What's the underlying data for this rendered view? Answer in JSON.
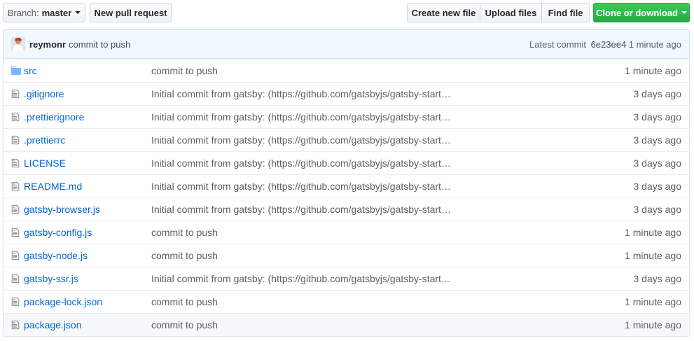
{
  "toolbar": {
    "branch_prefix": "Branch:",
    "branch_name": "master",
    "new_pr_label": "New pull request",
    "create_file_label": "Create new file",
    "upload_files_label": "Upload files",
    "find_file_label": "Find file",
    "clone_label": "Clone or download"
  },
  "latest_commit": {
    "author": "reymonr",
    "message": "commit to push",
    "prefix": "Latest commit",
    "sha": "6e23ee4",
    "age": "1 minute ago"
  },
  "files": [
    {
      "type": "folder",
      "icon": "folder-icon",
      "name": "src",
      "message": "commit to push",
      "age": "1 minute ago"
    },
    {
      "type": "file",
      "icon": "file-icon",
      "name": ".gitignore",
      "message": "Initial commit from gatsby: (https://github.com/gatsbyjs/gatsby-start…",
      "age": "3 days ago"
    },
    {
      "type": "file",
      "icon": "file-icon",
      "name": ".prettierignore",
      "message": "Initial commit from gatsby: (https://github.com/gatsbyjs/gatsby-start…",
      "age": "3 days ago"
    },
    {
      "type": "file",
      "icon": "file-icon",
      "name": ".prettierrc",
      "message": "Initial commit from gatsby: (https://github.com/gatsbyjs/gatsby-start…",
      "age": "3 days ago"
    },
    {
      "type": "file",
      "icon": "file-icon",
      "name": "LICENSE",
      "message": "Initial commit from gatsby: (https://github.com/gatsbyjs/gatsby-start…",
      "age": "3 days ago"
    },
    {
      "type": "file",
      "icon": "file-icon",
      "name": "README.md",
      "message": "Initial commit from gatsby: (https://github.com/gatsbyjs/gatsby-start…",
      "age": "3 days ago"
    },
    {
      "type": "file",
      "icon": "file-icon",
      "name": "gatsby-browser.js",
      "message": "Initial commit from gatsby: (https://github.com/gatsbyjs/gatsby-start…",
      "age": "3 days ago"
    },
    {
      "type": "file",
      "icon": "file-icon",
      "name": "gatsby-config.js",
      "message": "commit to push",
      "age": "1 minute ago"
    },
    {
      "type": "file",
      "icon": "file-icon",
      "name": "gatsby-node.js",
      "message": "commit to push",
      "age": "1 minute ago"
    },
    {
      "type": "file",
      "icon": "file-icon",
      "name": "gatsby-ssr.js",
      "message": "Initial commit from gatsby: (https://github.com/gatsbyjs/gatsby-start…",
      "age": "3 days ago"
    },
    {
      "type": "file",
      "icon": "file-icon",
      "name": "package-lock.json",
      "message": "commit to push",
      "age": "1 minute ago"
    },
    {
      "type": "file",
      "icon": "file-icon",
      "name": "package.json",
      "message": "commit to push",
      "age": "1 minute ago"
    }
  ],
  "colors": {
    "link": "#0366d6",
    "clone_button": "#28a745",
    "commit_bar_bg": "#f1f8ff",
    "folder_icon": "#79b8ff"
  }
}
